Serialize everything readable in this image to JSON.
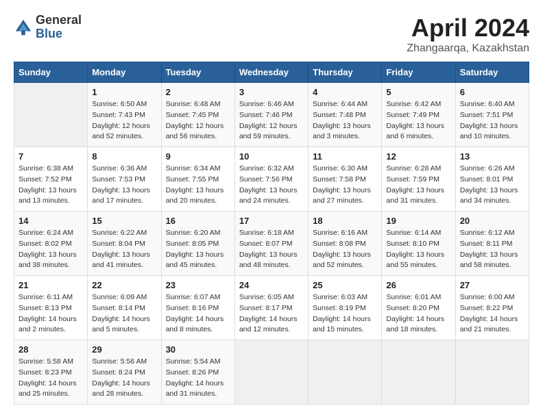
{
  "header": {
    "logo_general": "General",
    "logo_blue": "Blue",
    "title": "April 2024",
    "subtitle": "Zhangaarqa, Kazakhstan"
  },
  "columns": [
    "Sunday",
    "Monday",
    "Tuesday",
    "Wednesday",
    "Thursday",
    "Friday",
    "Saturday"
  ],
  "weeks": [
    [
      {
        "day": "",
        "info": ""
      },
      {
        "day": "1",
        "info": "Sunrise: 6:50 AM\nSunset: 7:43 PM\nDaylight: 12 hours\nand 52 minutes."
      },
      {
        "day": "2",
        "info": "Sunrise: 6:48 AM\nSunset: 7:45 PM\nDaylight: 12 hours\nand 56 minutes."
      },
      {
        "day": "3",
        "info": "Sunrise: 6:46 AM\nSunset: 7:46 PM\nDaylight: 12 hours\nand 59 minutes."
      },
      {
        "day": "4",
        "info": "Sunrise: 6:44 AM\nSunset: 7:48 PM\nDaylight: 13 hours\nand 3 minutes."
      },
      {
        "day": "5",
        "info": "Sunrise: 6:42 AM\nSunset: 7:49 PM\nDaylight: 13 hours\nand 6 minutes."
      },
      {
        "day": "6",
        "info": "Sunrise: 6:40 AM\nSunset: 7:51 PM\nDaylight: 13 hours\nand 10 minutes."
      }
    ],
    [
      {
        "day": "7",
        "info": "Sunrise: 6:38 AM\nSunset: 7:52 PM\nDaylight: 13 hours\nand 13 minutes."
      },
      {
        "day": "8",
        "info": "Sunrise: 6:36 AM\nSunset: 7:53 PM\nDaylight: 13 hours\nand 17 minutes."
      },
      {
        "day": "9",
        "info": "Sunrise: 6:34 AM\nSunset: 7:55 PM\nDaylight: 13 hours\nand 20 minutes."
      },
      {
        "day": "10",
        "info": "Sunrise: 6:32 AM\nSunset: 7:56 PM\nDaylight: 13 hours\nand 24 minutes."
      },
      {
        "day": "11",
        "info": "Sunrise: 6:30 AM\nSunset: 7:58 PM\nDaylight: 13 hours\nand 27 minutes."
      },
      {
        "day": "12",
        "info": "Sunrise: 6:28 AM\nSunset: 7:59 PM\nDaylight: 13 hours\nand 31 minutes."
      },
      {
        "day": "13",
        "info": "Sunrise: 6:26 AM\nSunset: 8:01 PM\nDaylight: 13 hours\nand 34 minutes."
      }
    ],
    [
      {
        "day": "14",
        "info": "Sunrise: 6:24 AM\nSunset: 8:02 PM\nDaylight: 13 hours\nand 38 minutes."
      },
      {
        "day": "15",
        "info": "Sunrise: 6:22 AM\nSunset: 8:04 PM\nDaylight: 13 hours\nand 41 minutes."
      },
      {
        "day": "16",
        "info": "Sunrise: 6:20 AM\nSunset: 8:05 PM\nDaylight: 13 hours\nand 45 minutes."
      },
      {
        "day": "17",
        "info": "Sunrise: 6:18 AM\nSunset: 8:07 PM\nDaylight: 13 hours\nand 48 minutes."
      },
      {
        "day": "18",
        "info": "Sunrise: 6:16 AM\nSunset: 8:08 PM\nDaylight: 13 hours\nand 52 minutes."
      },
      {
        "day": "19",
        "info": "Sunrise: 6:14 AM\nSunset: 8:10 PM\nDaylight: 13 hours\nand 55 minutes."
      },
      {
        "day": "20",
        "info": "Sunrise: 6:12 AM\nSunset: 8:11 PM\nDaylight: 13 hours\nand 58 minutes."
      }
    ],
    [
      {
        "day": "21",
        "info": "Sunrise: 6:11 AM\nSunset: 8:13 PM\nDaylight: 14 hours\nand 2 minutes."
      },
      {
        "day": "22",
        "info": "Sunrise: 6:09 AM\nSunset: 8:14 PM\nDaylight: 14 hours\nand 5 minutes."
      },
      {
        "day": "23",
        "info": "Sunrise: 6:07 AM\nSunset: 8:16 PM\nDaylight: 14 hours\nand 8 minutes."
      },
      {
        "day": "24",
        "info": "Sunrise: 6:05 AM\nSunset: 8:17 PM\nDaylight: 14 hours\nand 12 minutes."
      },
      {
        "day": "25",
        "info": "Sunrise: 6:03 AM\nSunset: 8:19 PM\nDaylight: 14 hours\nand 15 minutes."
      },
      {
        "day": "26",
        "info": "Sunrise: 6:01 AM\nSunset: 8:20 PM\nDaylight: 14 hours\nand 18 minutes."
      },
      {
        "day": "27",
        "info": "Sunrise: 6:00 AM\nSunset: 8:22 PM\nDaylight: 14 hours\nand 21 minutes."
      }
    ],
    [
      {
        "day": "28",
        "info": "Sunrise: 5:58 AM\nSunset: 8:23 PM\nDaylight: 14 hours\nand 25 minutes."
      },
      {
        "day": "29",
        "info": "Sunrise: 5:56 AM\nSunset: 8:24 PM\nDaylight: 14 hours\nand 28 minutes."
      },
      {
        "day": "30",
        "info": "Sunrise: 5:54 AM\nSunset: 8:26 PM\nDaylight: 14 hours\nand 31 minutes."
      },
      {
        "day": "",
        "info": ""
      },
      {
        "day": "",
        "info": ""
      },
      {
        "day": "",
        "info": ""
      },
      {
        "day": "",
        "info": ""
      }
    ]
  ]
}
